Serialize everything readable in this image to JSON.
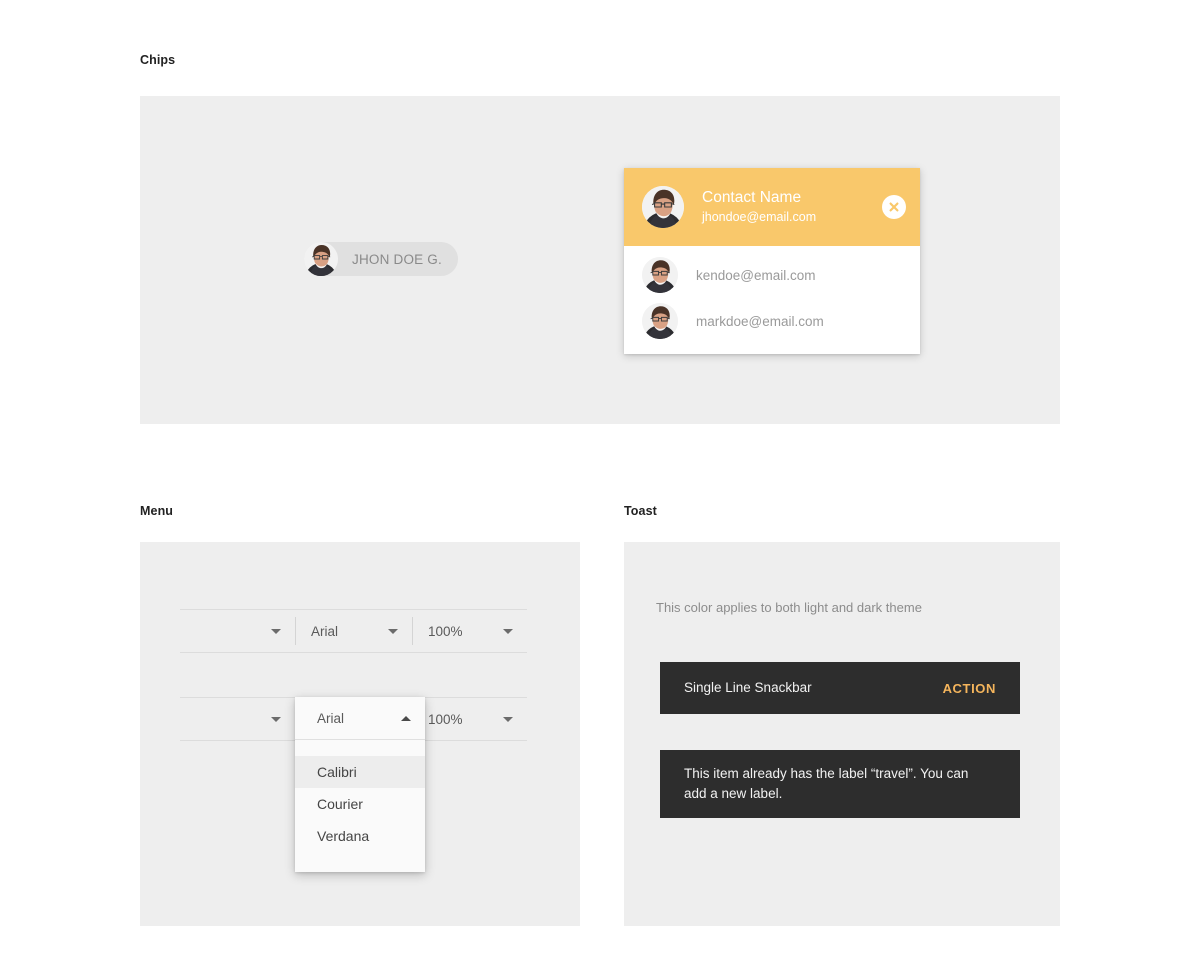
{
  "sections": {
    "chips": {
      "label": "Chips"
    },
    "menu": {
      "label": "Menu"
    },
    "toast": {
      "label": "Toast"
    }
  },
  "chip": {
    "label": "JHON DOE G.",
    "avatar_icon": "person-avatar-photo"
  },
  "contact_card": {
    "header": {
      "name": "Contact Name",
      "email": "jhondoe@email.com",
      "avatar_icon": "person-avatar-photo",
      "close_icon": "close-circle-icon",
      "background_color": "#F9C86B",
      "text_color": "#FFFFFF"
    },
    "rows": [
      {
        "email": "kendoe@email.com",
        "avatar_icon": "person-avatar-photo"
      },
      {
        "email": "markdoe@email.com",
        "avatar_icon": "person-avatar-photo"
      }
    ]
  },
  "menu": {
    "toolbar_closed": {
      "cells": [
        {
          "value": "",
          "caret_icon": "chevron-down-icon"
        },
        {
          "value": "Arial",
          "caret_icon": "chevron-down-icon"
        },
        {
          "value": "100%",
          "caret_icon": "chevron-down-icon"
        }
      ]
    },
    "toolbar_open": {
      "cells": [
        {
          "value": "",
          "caret_icon": "chevron-down-icon"
        },
        {
          "value": "Arial",
          "caret_icon": "chevron-up-icon"
        },
        {
          "value": "100%",
          "caret_icon": "chevron-down-icon"
        }
      ]
    },
    "dropdown": {
      "selected": "Arial",
      "caret_icon": "chevron-up-icon",
      "options": [
        {
          "label": "Calibri",
          "hovered": true
        },
        {
          "label": "Courier",
          "hovered": false
        },
        {
          "label": "Verdana",
          "hovered": false
        }
      ],
      "hover_color": "#EDEDED"
    }
  },
  "toast": {
    "note": "This color applies to both light and dark theme",
    "snackbars": [
      {
        "message": "Single Line Snackbar",
        "action": "ACTION",
        "background_color": "#2D2D2D",
        "action_color": "#F5B55C"
      },
      {
        "message": "This item already has the label “travel”. You can add a new label.",
        "action": "",
        "background_color": "#2D2D2D"
      }
    ]
  }
}
